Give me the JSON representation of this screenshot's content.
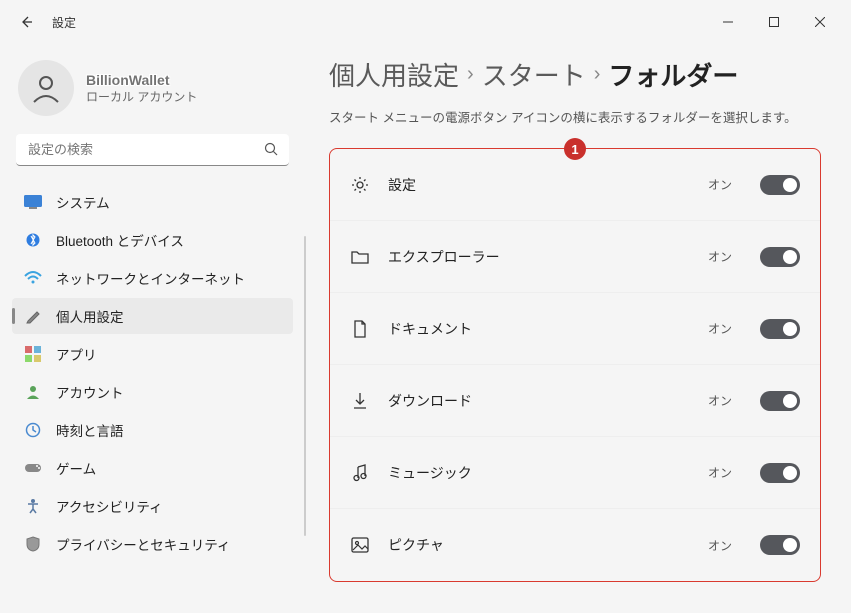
{
  "window": {
    "title": "設定"
  },
  "user": {
    "name": "BillionWallet",
    "sub": "ローカル アカウント"
  },
  "search": {
    "placeholder": "設定の検索"
  },
  "nav": {
    "items": [
      {
        "label": "システム"
      },
      {
        "label": "Bluetooth とデバイス"
      },
      {
        "label": "ネットワークとインターネット"
      },
      {
        "label": "個人用設定"
      },
      {
        "label": "アプリ"
      },
      {
        "label": "アカウント"
      },
      {
        "label": "時刻と言語"
      },
      {
        "label": "ゲーム"
      },
      {
        "label": "アクセシビリティ"
      },
      {
        "label": "プライバシーとセキュリティ"
      }
    ]
  },
  "breadcrumb": {
    "c0": "個人用設定",
    "c1": "スタート",
    "c2": "フォルダー"
  },
  "description": "スタート メニューの電源ボタン アイコンの横に表示するフォルダーを選択します。",
  "badge": "1",
  "rows": [
    {
      "label": "設定",
      "state": "オン"
    },
    {
      "label": "エクスプローラー",
      "state": "オン"
    },
    {
      "label": "ドキュメント",
      "state": "オン"
    },
    {
      "label": "ダウンロード",
      "state": "オン"
    },
    {
      "label": "ミュージック",
      "state": "オン"
    },
    {
      "label": "ピクチャ",
      "state": "オン"
    }
  ]
}
